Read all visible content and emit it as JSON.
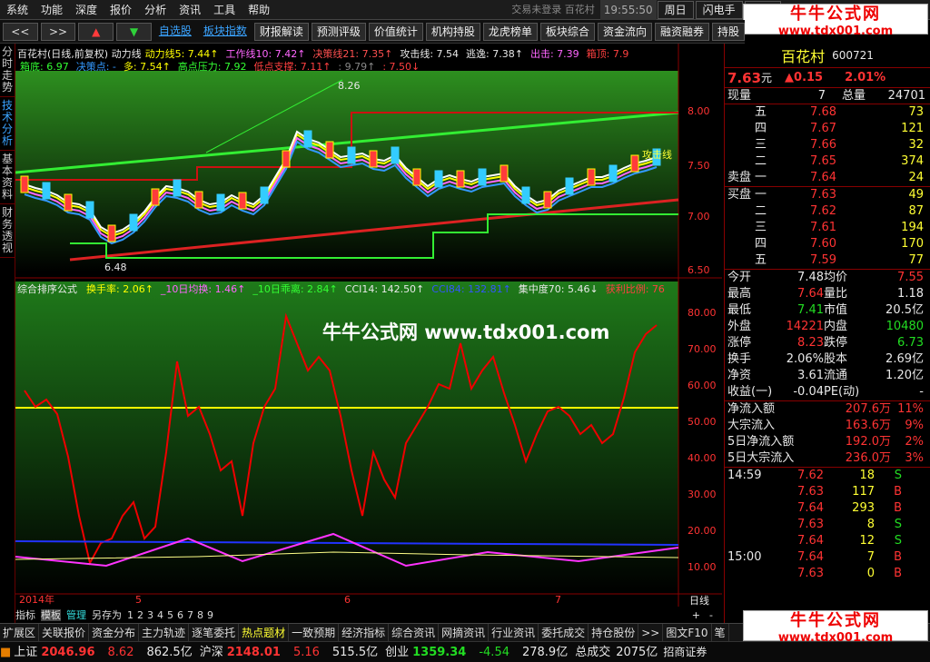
{
  "menu": {
    "items": [
      "系统",
      "功能",
      "深度",
      "报价",
      "分析",
      "资讯",
      "工具",
      "帮助"
    ],
    "title": "交易未登录  百花村",
    "time": "19:55:50",
    "buttons": [
      "周日",
      "闪电手",
      "行情"
    ]
  },
  "watermark": {
    "cn": "牛牛公式网",
    "url": "www.tdx001.com",
    "center": "牛牛公式网 www.tdx001.com"
  },
  "toolbar": {
    "nav": [
      "<<",
      ">>"
    ],
    "links": [
      "自选股",
      "板块指数"
    ],
    "buttons": [
      "财报解读",
      "预测评级",
      "价值统计",
      "机构持股",
      "龙虎榜单",
      "板块综合",
      "资金流向",
      "融资融券",
      "持股"
    ]
  },
  "sidetabs": [
    {
      "label": "分时走势"
    },
    {
      "label": "技术分析"
    },
    {
      "label": "基本资料"
    },
    {
      "label": "财务透视"
    }
  ],
  "main": {
    "header": "百花村(日线,前复权) 动力线",
    "ind1": [
      {
        "t": "动力线5: 7.44↑",
        "c": "#ffff00"
      },
      {
        "t": "工作线10: 7.42↑",
        "c": "#ff66ff"
      },
      {
        "t": "决策线21: 7.35↑",
        "c": "#ff5050"
      },
      {
        "t": "攻击线: 7.54",
        "c": "#e8e8e8"
      },
      {
        "t": "逃逸: 7.38↑",
        "c": "#e8e8e8"
      },
      {
        "t": "出击: 7.39",
        "c": "#ff66ff"
      },
      {
        "t": "箱顶: 7.9",
        "c": "#ff4040"
      }
    ],
    "ind1b": [
      {
        "t": "箱底: 6.97",
        "c": "#33ff33"
      },
      {
        "t": "决策点: -",
        "c": "#3399ff"
      },
      {
        "t": "多: 7.54↑",
        "c": "#ffff00"
      },
      {
        "t": "高点压力: 7.92",
        "c": "#33ff33"
      },
      {
        "t": "低点支撑: 7.11↑",
        "c": "#ff4040"
      },
      {
        "t": ": 9.79↑",
        "c": "#888888"
      },
      {
        "t": ": 7.50↓",
        "c": "#ff4040"
      }
    ],
    "yaxis_top": [
      "8.00",
      "7.50",
      "7.00",
      "6.50"
    ],
    "annotations": {
      "high": "8.26",
      "low": "6.48",
      "attack": "攻击线"
    },
    "sub_header": "综合排序公式",
    "ind2": [
      {
        "t": "换手率: 2.06↑",
        "c": "#ffff00"
      },
      {
        "t": "_10日均换: 1.46↑",
        "c": "#ff66ff"
      },
      {
        "t": "_10日乖离: 2.84↑",
        "c": "#33ff33"
      },
      {
        "t": "CCI14: 142.50↑",
        "c": "#e8e8e8"
      },
      {
        "t": "CCI84: 132.81↑",
        "c": "#3355ff"
      },
      {
        "t": "集中度70: 5.46↓",
        "c": "#e8e8e8"
      },
      {
        "t": "获利比例: 76",
        "c": "#ff4040"
      }
    ],
    "yaxis_bottom": [
      "80.00",
      "70.00",
      "60.00",
      "50.00",
      "40.00",
      "30.00",
      "20.00",
      "10.00"
    ],
    "xaxis": [
      "2014年",
      "5",
      "6",
      "7"
    ],
    "period": "日线",
    "bottom_tools": [
      "指标",
      "模板",
      "管理",
      "另存为",
      "1",
      "2",
      "3",
      "4",
      "5",
      "6",
      "7",
      "8",
      "9"
    ],
    "zoom": [
      "+",
      "-"
    ]
  },
  "quote": {
    "name": "百花村",
    "code": "600721",
    "price": "7.63",
    "unit": "元",
    "change": "▲0.15",
    "pct": "2.01%",
    "now_lbl": "现量",
    "now": "7",
    "total_lbl": "总量",
    "total": "24701",
    "asks": [
      {
        "l": "五",
        "p": "7.68",
        "v": "73"
      },
      {
        "l": "四",
        "p": "7.67",
        "v": "121"
      },
      {
        "l": "三",
        "p": "7.66",
        "v": "32"
      },
      {
        "l": "二",
        "p": "7.65",
        "v": "374"
      },
      {
        "l": "一",
        "p": "7.64",
        "v": "24"
      }
    ],
    "sell_lbl": "卖盘",
    "buy_lbl": "买盘",
    "bids": [
      {
        "l": "一",
        "p": "7.63",
        "v": "49"
      },
      {
        "l": "二",
        "p": "7.62",
        "v": "87"
      },
      {
        "l": "三",
        "p": "7.61",
        "v": "194"
      },
      {
        "l": "四",
        "p": "7.60",
        "v": "170"
      },
      {
        "l": "五",
        "p": "7.59",
        "v": "77"
      }
    ],
    "stats": [
      [
        {
          "l": "今开",
          "v": "7.48",
          "c": "wht"
        },
        {
          "l": "均价",
          "v": "7.55",
          "c": "red"
        }
      ],
      [
        {
          "l": "最高",
          "v": "7.64",
          "c": "red"
        },
        {
          "l": "量比",
          "v": "1.18",
          "c": "wht"
        }
      ],
      [
        {
          "l": "最低",
          "v": "7.41",
          "c": "grn"
        },
        {
          "l": "市值",
          "v": "20.5亿",
          "c": "wht"
        }
      ],
      [
        {
          "l": "外盘",
          "v": "14221",
          "c": "red"
        },
        {
          "l": "内盘",
          "v": "10480",
          "c": "grn"
        }
      ],
      [
        {
          "l": "涨停",
          "v": "8.23",
          "c": "red"
        },
        {
          "l": "跌停",
          "v": "6.73",
          "c": "grn"
        }
      ],
      [
        {
          "l": "换手",
          "v": "2.06%",
          "c": "wht"
        },
        {
          "l": "股本",
          "v": "2.69亿",
          "c": "wht"
        }
      ],
      [
        {
          "l": "净资",
          "v": "3.61",
          "c": "wht"
        },
        {
          "l": "流通",
          "v": "1.20亿",
          "c": "wht"
        }
      ],
      [
        {
          "l": "收益(一)",
          "v": "-0.04",
          "c": "wht"
        },
        {
          "l": "PE(动)",
          "v": "-",
          "c": "wht"
        }
      ]
    ],
    "flows": [
      {
        "l": "净流入额",
        "v": "207.6万",
        "p": "11%"
      },
      {
        "l": "大宗流入",
        "v": "163.6万",
        "p": "9%"
      },
      {
        "l": "5日净流入额",
        "v": "192.0万",
        "p": "2%"
      },
      {
        "l": "5日大宗流入",
        "v": "236.0万",
        "p": "3%"
      }
    ],
    "ticks": [
      {
        "t": "14:59",
        "p": "7.62",
        "v": "18",
        "s": "S"
      },
      {
        "t": "",
        "p": "7.63",
        "v": "117",
        "s": "B"
      },
      {
        "t": "",
        "p": "7.64",
        "v": "293",
        "s": "B"
      },
      {
        "t": "",
        "p": "7.63",
        "v": "8",
        "s": "S"
      },
      {
        "t": "",
        "p": "7.64",
        "v": "12",
        "s": "S"
      },
      {
        "t": "15:00",
        "p": "7.64",
        "v": "7",
        "s": "B"
      },
      {
        "t": "",
        "p": "7.63",
        "v": "0",
        "s": "B"
      }
    ]
  },
  "bottomtabs": [
    "扩展区",
    "关联报价",
    "资金分布",
    "主力轨迹",
    "逐笔委托",
    "热点题材",
    "一致预期",
    "经济指标",
    "综合资讯",
    "网摘资讯",
    "行业资讯",
    "委托成交",
    "持仓股份",
    ">>",
    "图文F10",
    "笔"
  ],
  "status": [
    {
      "n": "上证",
      "v": "2046.96",
      "c": "8.62",
      "a": "862.5亿"
    },
    {
      "n": "沪深",
      "v": "2148.01",
      "c": "5.16",
      "a": "515.5亿"
    },
    {
      "n": "创业",
      "v": "1359.34",
      "c": "-4.54",
      "a": "278.9亿"
    }
  ],
  "status_extra": {
    "l": "总成交",
    "v": "2075亿",
    "broker": "招商证券"
  }
}
